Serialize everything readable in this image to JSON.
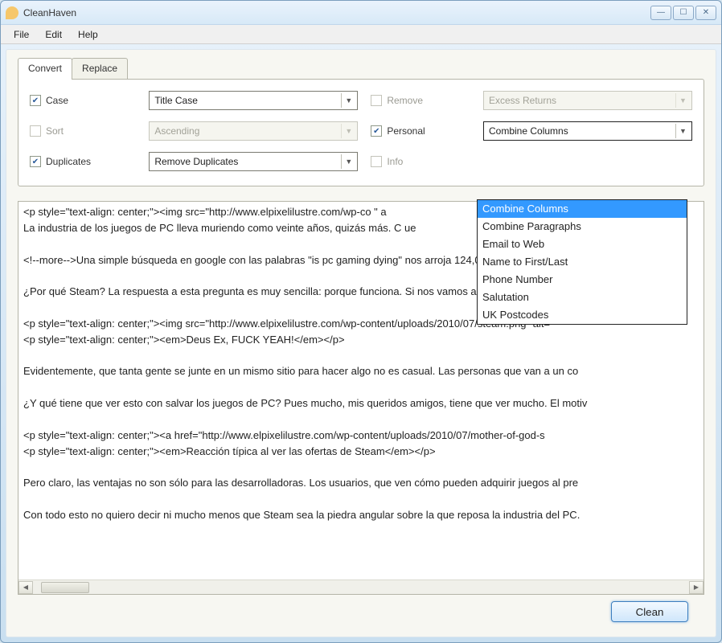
{
  "window": {
    "title": "CleanHaven"
  },
  "menu": {
    "items": [
      "File",
      "Edit",
      "Help"
    ]
  },
  "tabs": {
    "items": [
      {
        "label": "Convert",
        "active": true
      },
      {
        "label": "Replace",
        "active": false
      }
    ]
  },
  "options": {
    "case": {
      "label": "Case",
      "checked": true,
      "value": "Title Case",
      "enabled": true
    },
    "sort": {
      "label": "Sort",
      "checked": false,
      "value": "Ascending",
      "enabled": false
    },
    "duplicates": {
      "label": "Duplicates",
      "checked": true,
      "value": "Remove Duplicates",
      "enabled": true
    },
    "remove": {
      "label": "Remove",
      "checked": false,
      "value": "Excess Returns",
      "enabled": false
    },
    "personal": {
      "label": "Personal",
      "checked": true,
      "value": "Combine Columns",
      "enabled": true
    },
    "info": {
      "label": "Info",
      "checked": false,
      "value": "",
      "enabled": false
    }
  },
  "personal_dropdown": {
    "selected": "Combine Columns",
    "items": [
      "Combine Columns",
      "Combine Paragraphs",
      "Email to Web",
      "Name to First/Last",
      "Phone Number",
      "Salutation",
      "UK Postcodes"
    ]
  },
  "text_lines": [
    "<p style=\"text-align: center;\"><img src=\"http://www.elpixelilustre.com/wp-co                                                                \" a",
    "La industria de los juegos de PC lleva muriendo como veinte años, quizás más. C                                                                ue",
    "",
    "<!--more-->Una simple búsqueda en google con las palabras \"is pc gaming dying\" nos arroja 124,000 resultados, entre",
    "",
    "¿Por qué Steam? La respuesta a esta pregunta es muy sencilla: porque funciona. Si nos vamos a la página web del giga",
    "",
    "<p style=\"text-align: center;\"><img src=\"http://www.elpixelilustre.com/wp-content/uploads/2010/07/steam.png\" alt=",
    "<p style=\"text-align: center;\"><em>Deus Ex, FUCK YEAH!</em></p>",
    "",
    "Evidentemente, que tanta gente se junte en un mismo sitio para hacer algo no es casual. Las personas que van a un co",
    "",
    "¿Y qué tiene que ver esto con salvar los juegos de PC? Pues mucho, mis queridos amigos, tiene que ver mucho. El motiv",
    "",
    "<p style=\"text-align: center;\"><a href=\"http://www.elpixelilustre.com/wp-content/uploads/2010/07/mother-of-god-s",
    "<p style=\"text-align: center;\"><em>Reacción típica al ver las ofertas de Steam</em></p>",
    "",
    "Pero claro, las ventajas no son sólo para las desarrolladoras. Los usuarios, que ven cómo pueden adquirir juegos al pre",
    "",
    "Con todo esto no quiero decir ni mucho menos que Steam sea la piedra angular sobre la que reposa la industria del PC."
  ],
  "footer": {
    "clean_label": "Clean"
  }
}
